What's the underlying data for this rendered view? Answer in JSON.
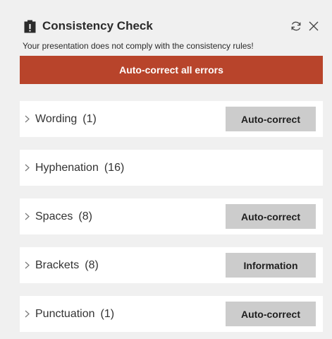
{
  "header": {
    "title": "Consistency Check",
    "title_icon": "clipboard-alert-icon",
    "refresh_icon": "refresh-icon",
    "close_icon": "close-icon"
  },
  "subtitle": "Your presentation does not comply with the consistency rules!",
  "autocorrect_all_label": "Auto-correct all errors",
  "colors": {
    "accent": "#b8442b",
    "row_background": "#ffffff",
    "button_gray": "#cccccc",
    "panel_background": "#f0f0f0"
  },
  "categories": [
    {
      "name": "Wording",
      "count": "(1)",
      "action": "Auto-correct"
    },
    {
      "name": "Hyphenation",
      "count": "(16)",
      "action": null
    },
    {
      "name": "Spaces",
      "count": "(8)",
      "action": "Auto-correct"
    },
    {
      "name": "Brackets",
      "count": "(8)",
      "action": "Information"
    },
    {
      "name": "Punctuation",
      "count": "(1)",
      "action": "Auto-correct"
    }
  ]
}
